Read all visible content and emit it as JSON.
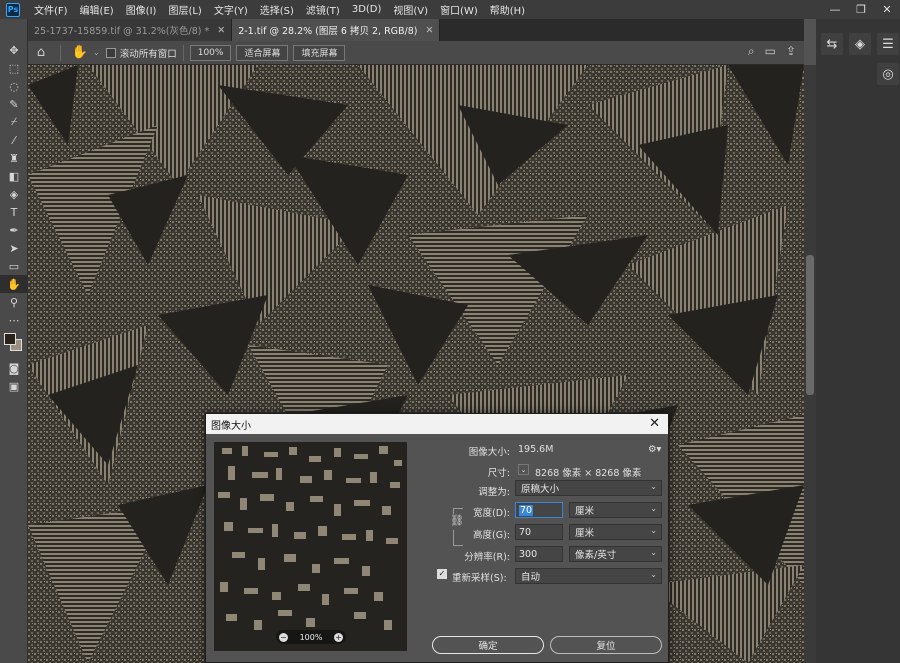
{
  "menubar": {
    "logo": "Ps",
    "items": [
      "文件(F)",
      "编辑(E)",
      "图像(I)",
      "图层(L)",
      "文字(Y)",
      "选择(S)",
      "滤镜(T)",
      "3D(D)",
      "视图(V)",
      "窗口(W)",
      "帮助(H)"
    ],
    "controls": [
      "—",
      "❐",
      "✕"
    ]
  },
  "tabs": [
    {
      "label": "25-1737-15859.tif @ 31.2%(灰色/8) *",
      "close": "✕"
    },
    {
      "label": "2-1.tif @ 28.2% (图层 6 拷贝 2, RGB/8)",
      "close": "✕"
    }
  ],
  "options": {
    "scroll_all_label": "滚动所有窗口",
    "zoom_value": "100%",
    "fit_screen": "适合屏幕",
    "fill_screen": "填充屏幕"
  },
  "dialog": {
    "title": "图像大小",
    "close": "✕",
    "image_size_label": "图像大小:",
    "image_size_value": "195.6M",
    "dimensions_label": "尺寸:",
    "dimensions_value": "8268 像素  ×  8268 像素",
    "fit_to_label": "调整为:",
    "fit_to_value": "原稿大小",
    "width_label": "宽度(D):",
    "width_value": "70",
    "width_unit": "厘米",
    "height_label": "高度(G):",
    "height_value": "70",
    "height_unit": "厘米",
    "resolution_label": "分辨率(R):",
    "resolution_value": "300",
    "resolution_unit": "像素/英寸",
    "resample_label": "重新采样(S):",
    "resample_value": "自动",
    "preview_zoom": "100%",
    "ok": "确定",
    "reset": "复位"
  },
  "colors": {
    "fabric_dark": "#23221e",
    "fabric_light": "#8f8676"
  }
}
